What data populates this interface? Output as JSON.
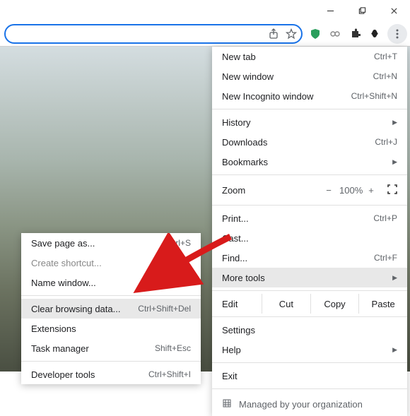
{
  "titlebar": {
    "buttons": [
      "min",
      "max",
      "close"
    ]
  },
  "main_menu": [
    {
      "type": "item",
      "label": "New tab",
      "shortcut": "Ctrl+T"
    },
    {
      "type": "item",
      "label": "New window",
      "shortcut": "Ctrl+N"
    },
    {
      "type": "item",
      "label": "New Incognito window",
      "shortcut": "Ctrl+Shift+N"
    },
    {
      "type": "sep"
    },
    {
      "type": "item",
      "label": "History",
      "arrow": true
    },
    {
      "type": "item",
      "label": "Downloads",
      "shortcut": "Ctrl+J"
    },
    {
      "type": "item",
      "label": "Bookmarks",
      "arrow": true
    },
    {
      "type": "sep"
    },
    {
      "type": "zoom",
      "label": "Zoom",
      "value": "100%"
    },
    {
      "type": "sep"
    },
    {
      "type": "item",
      "label": "Print...",
      "shortcut": "Ctrl+P"
    },
    {
      "type": "item",
      "label": "Cast..."
    },
    {
      "type": "item",
      "label": "Find...",
      "shortcut": "Ctrl+F"
    },
    {
      "type": "item",
      "label": "More tools",
      "arrow": true,
      "hover": true
    },
    {
      "type": "sep"
    },
    {
      "type": "edit",
      "label": "Edit",
      "cut": "Cut",
      "copy": "Copy",
      "paste": "Paste"
    },
    {
      "type": "sep"
    },
    {
      "type": "item",
      "label": "Settings"
    },
    {
      "type": "item",
      "label": "Help",
      "arrow": true
    },
    {
      "type": "sep"
    },
    {
      "type": "item",
      "label": "Exit"
    },
    {
      "type": "sep"
    },
    {
      "type": "managed",
      "label": "Managed by your organization"
    }
  ],
  "sub_menu": [
    {
      "label": "Save page as...",
      "shortcut": "Ctrl+S"
    },
    {
      "label": "Create shortcut...",
      "dim": true
    },
    {
      "label": "Name window..."
    },
    {
      "type": "sep"
    },
    {
      "label": "Clear browsing data...",
      "shortcut": "Ctrl+Shift+Del",
      "hover": true
    },
    {
      "label": "Extensions"
    },
    {
      "label": "Task manager",
      "shortcut": "Shift+Esc"
    },
    {
      "type": "sep"
    },
    {
      "label": "Developer tools",
      "shortcut": "Ctrl+Shift+I"
    }
  ]
}
